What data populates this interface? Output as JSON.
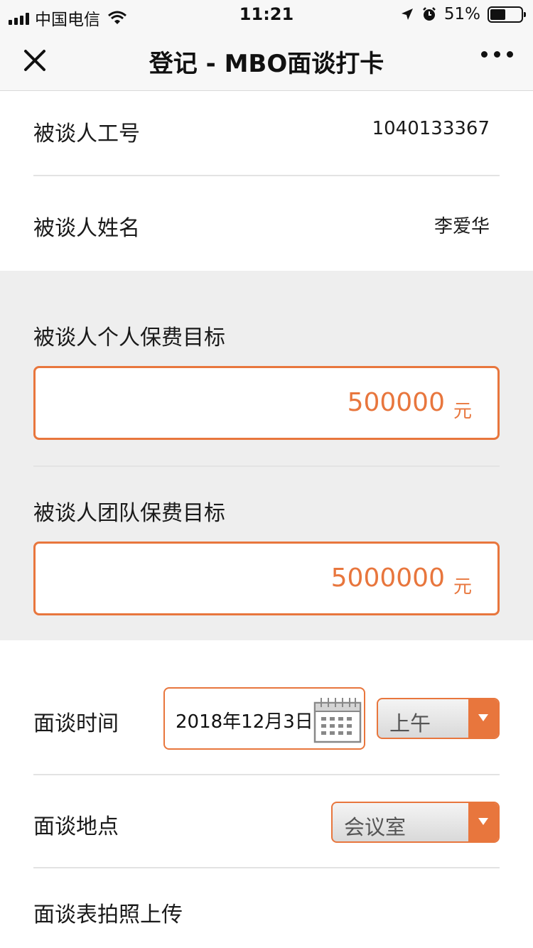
{
  "status_bar": {
    "carrier": "中国电信",
    "time": "11:21",
    "battery": "51%",
    "battery_level": 0.51
  },
  "nav": {
    "title": "登记 - MBO面谈打卡",
    "close_icon": "close-icon",
    "more_icon": "more-icon"
  },
  "info": {
    "employee_id_label": "被谈人工号",
    "employee_id_value": "1040133367",
    "name_label": "被谈人姓名",
    "name_value": "李爱华"
  },
  "targets": {
    "personal_label": "被谈人个人保费目标",
    "personal_value": "500000",
    "team_label": "被谈人团队保费目标",
    "team_value": "5000000",
    "unit": "元"
  },
  "interview": {
    "time_label": "面谈时间",
    "date_value": "2018年12月3日",
    "period_value": "上午",
    "place_label": "面谈地点",
    "place_value": "会议室",
    "photo_label": "面谈表拍照上传"
  },
  "colors": {
    "accent": "#e8763d",
    "section_bg": "#eeeeee"
  }
}
